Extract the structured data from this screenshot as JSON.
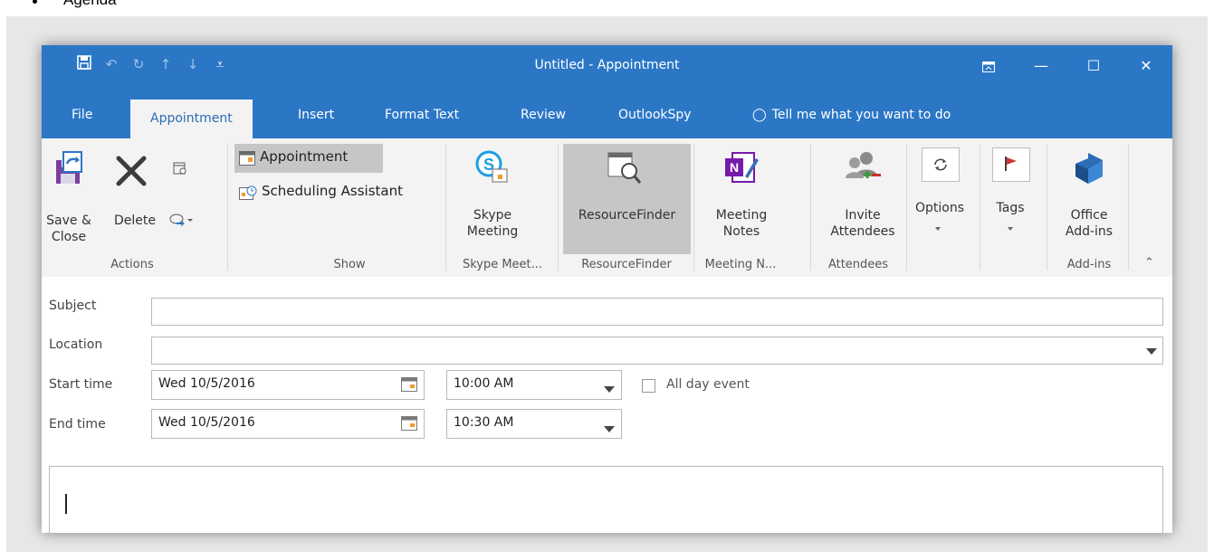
{
  "doc": {
    "bullet_text": "Agenda"
  },
  "window": {
    "title": "Untitled - Appointment",
    "quick_access": [
      "save-icon",
      "undo-icon",
      "redo-icon",
      "up-arrow-icon",
      "down-arrow-icon",
      "customize-icon"
    ]
  },
  "tabs": [
    "File",
    "Appointment",
    "Insert",
    "Format Text",
    "Review",
    "OutlookSpy"
  ],
  "tell_me": "Tell me what you want to do",
  "ribbon": {
    "save_close": "Save & Close",
    "save_close_1": "Save &",
    "save_close_2": "Close",
    "delete": "Delete",
    "appointment": "Appointment",
    "scheduling": "Scheduling Assistant",
    "skype_1": "Skype",
    "skype_2": "Meeting",
    "resourcefinder": "ResourceFinder",
    "notes_1": "Meeting",
    "notes_2": "Notes",
    "invite_1": "Invite",
    "invite_2": "Attendees",
    "options": "Options",
    "tags": "Tags",
    "office_1": "Office",
    "office_2": "Add-ins",
    "groups": {
      "actions": "Actions",
      "show": "Show",
      "skype": "Skype Meet...",
      "resource": "ResourceFinder",
      "notes": "Meeting N...",
      "attendees": "Attendees",
      "addins": "Add-ins"
    }
  },
  "form": {
    "subject_label": "Subject",
    "subject_value": "",
    "location_label": "Location",
    "location_value": "",
    "start_label": "Start time",
    "start_date": "Wed 10/5/2016",
    "start_time": "10:00 AM",
    "all_day": "All day event",
    "end_label": "End time",
    "end_date": "Wed 10/5/2016",
    "end_time": "10:30 AM"
  },
  "colors": {
    "accent": "#2b77c6",
    "ribbon_bg": "#f3f3f3",
    "highlight": "#c6c6c6"
  }
}
